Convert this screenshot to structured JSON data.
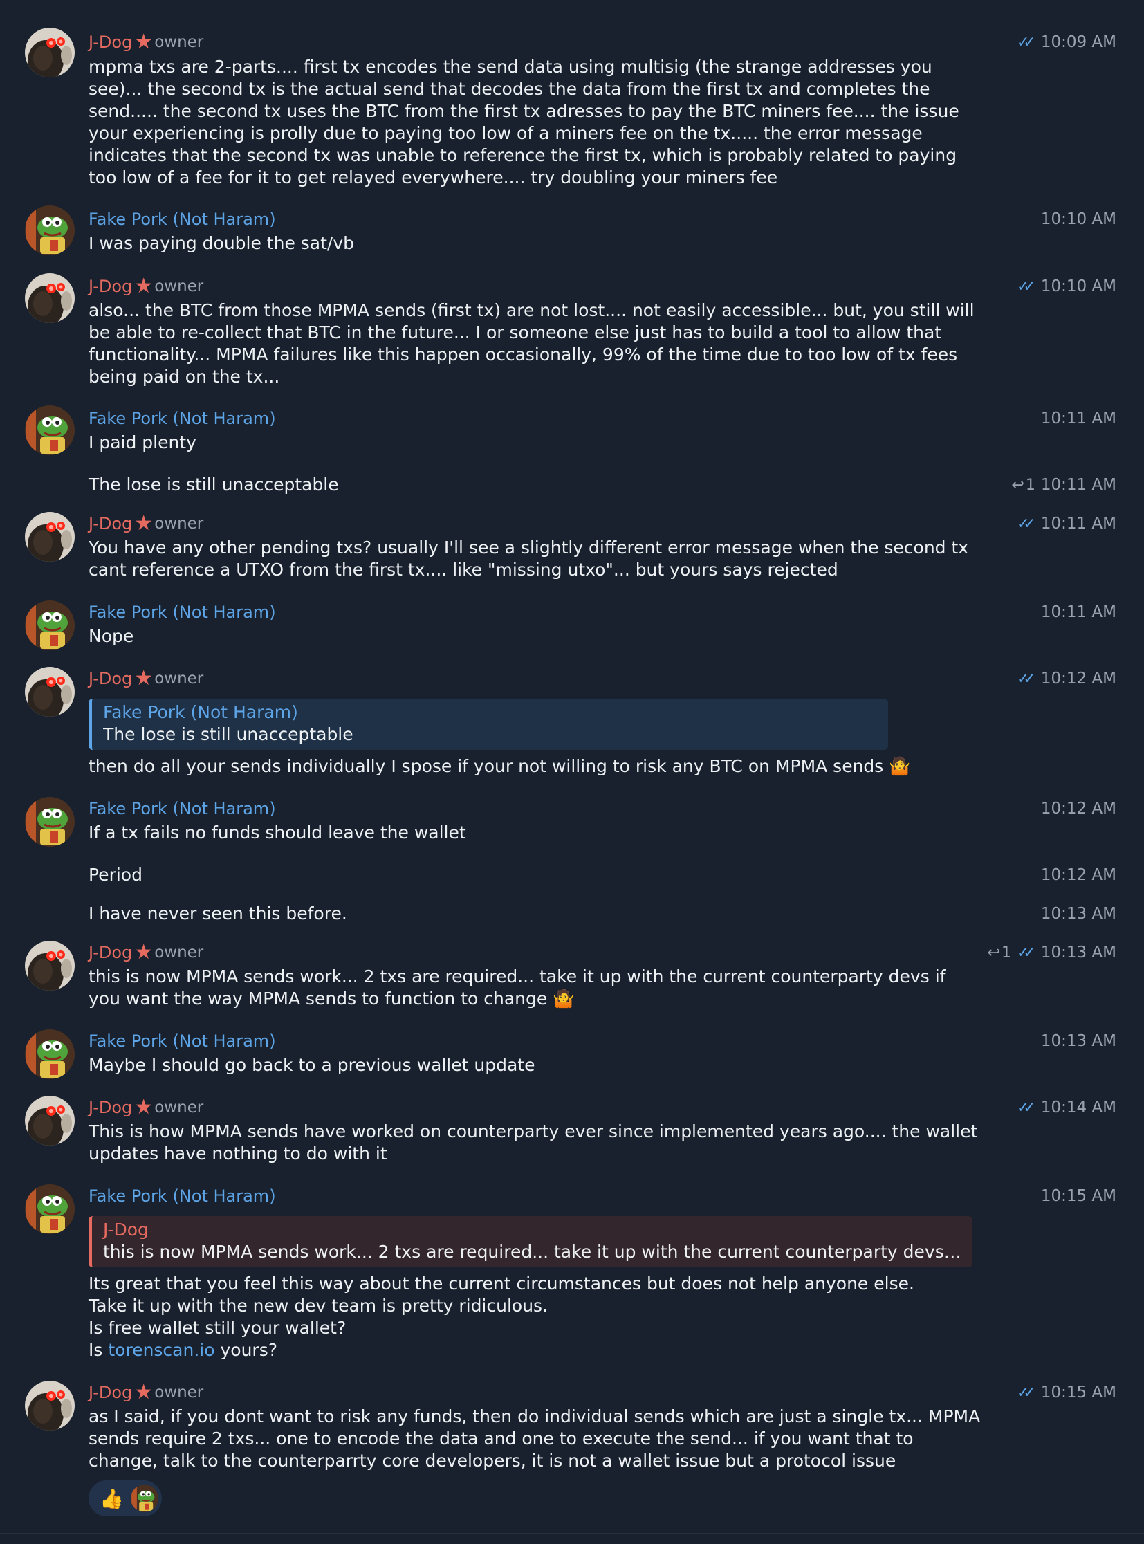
{
  "chat": {
    "role_label": "owner",
    "checks_glyph": "✓✓",
    "reply_glyph": "↩",
    "shrug_emoji": "🤷",
    "messages": [
      {
        "sender": "J-Dog",
        "time": "10:09 AM",
        "text": "mpma txs are 2-parts.... first tx encodes the send data  using multisig (the strange addresses you see)... the second tx is the actual send that decodes the data from the first tx and completes the send..... the second tx uses the BTC from the first tx adresses to pay the BTC miners fee.... the issue your experiencing is prolly due to paying too low of a miners fee on the tx..... the error message indicates that the second tx was unable to reference the first tx, which is probably related to paying too low of a fee for it to get relayed everywhere.... try doubling your miners fee"
      },
      {
        "sender": "Fake Pork (Not Haram)",
        "time": "10:10 AM",
        "text": "I was paying double the sat/vb"
      },
      {
        "sender": "J-Dog",
        "time": "10:10 AM",
        "text": "also... the BTC from those MPMA sends (first tx) are not lost.... not easily accessible... but, you still will be able to re-collect that BTC in the future... I or someone else just has to build a tool to allow that functionality... MPMA failures like this happen occasionally, 99% of the time due to too low of tx fees being paid on the tx..."
      },
      {
        "sender": "Fake Pork (Not Haram)",
        "time": "10:11 AM",
        "text": "I paid plenty"
      },
      {
        "sender": "Fake Pork (Not Haram)",
        "time": "10:11 AM",
        "replies": "1",
        "text": "The lose is still unacceptable"
      },
      {
        "sender": "J-Dog",
        "time": "10:11 AM",
        "text": "You have any other pending txs? usually I'll see a slightly different error message when the second tx cant reference a UTXO from the first tx.... like \"missing utxo\"... but yours says rejected"
      },
      {
        "sender": "Fake Pork (Not Haram)",
        "time": "10:11 AM",
        "text": "Nope"
      },
      {
        "sender": "J-Dog",
        "time": "10:12 AM",
        "quote_name": "Fake Pork (Not Haram)",
        "quote_text": "The lose is still unacceptable",
        "text": "then do all your sends individually I spose if your not willing to risk any BTC on MPMA sends"
      },
      {
        "sender": "Fake Pork (Not Haram)",
        "time": "10:12 AM",
        "text": "If a tx fails no funds should leave the wallet"
      },
      {
        "sender": "Fake Pork (Not Haram)",
        "time": "10:12 AM",
        "text": "Period"
      },
      {
        "sender": "Fake Pork (Not Haram)",
        "time": "10:13 AM",
        "text": "I have never seen this before."
      },
      {
        "sender": "J-Dog",
        "time": "10:13 AM",
        "replies": "1",
        "text": "this is now MPMA sends work... 2 txs are required... take it up with the current counterparty devs if you want the way MPMA sends to function to change"
      },
      {
        "sender": "Fake Pork (Not Haram)",
        "time": "10:13 AM",
        "text": "Maybe I should go back to a previous wallet update"
      },
      {
        "sender": "J-Dog",
        "time": "10:14 AM",
        "text": "This is how MPMA sends have worked on counterparty ever since implemented years ago.... the wallet updates have nothing to do with it"
      },
      {
        "sender": "Fake Pork (Not Haram)",
        "time": "10:15 AM",
        "quote_name": "J-Dog",
        "quote_text": "this is now MPMA sends work... 2 txs are required... take it up with the current counterparty devs if yo...",
        "text_lines": [
          "Its great that you feel this way about the current circumstances but does not help anyone else.",
          "Take it up with the new dev team is pretty ridiculous.",
          "Is free wallet still your wallet?"
        ],
        "text_prefix": "Is ",
        "link": "torenscan.io",
        "text_suffix": " yours?"
      },
      {
        "sender": "J-Dog",
        "time": "10:15 AM",
        "text": "as I said, if you dont want to risk any funds, then do individual sends which are just a single tx... MPMA sends require 2 txs... one to encode the data and one to execute the send... if you want that to change, talk to the counterparrty core developers, it is not a wallet issue but a protocol issue",
        "reaction_emoji": "👍"
      }
    ]
  }
}
